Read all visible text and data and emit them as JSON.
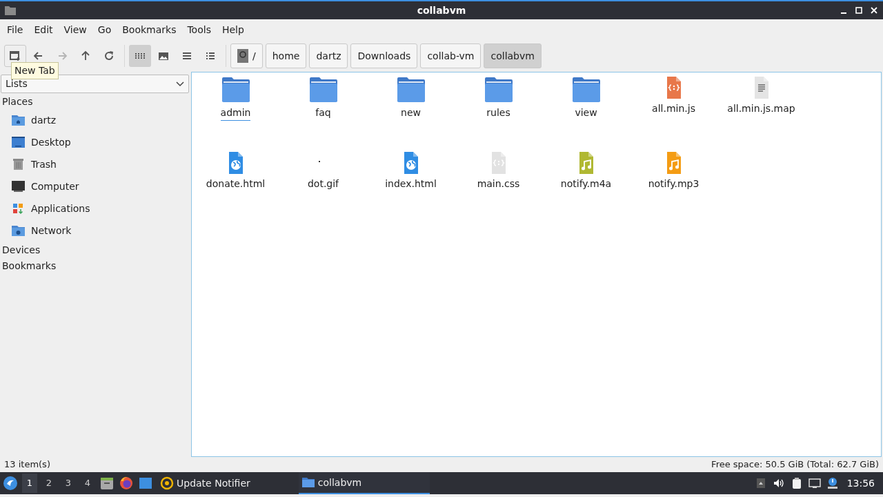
{
  "window": {
    "title": "collabvm"
  },
  "menu": [
    "File",
    "Edit",
    "View",
    "Go",
    "Bookmarks",
    "Tools",
    "Help"
  ],
  "toolbar": {
    "navigation": [
      {
        "kind": "new-tab",
        "disabled": false
      },
      {
        "kind": "back",
        "disabled": false
      },
      {
        "kind": "forward",
        "disabled": true
      },
      {
        "kind": "up",
        "disabled": false
      },
      {
        "kind": "reload",
        "disabled": false
      }
    ],
    "view_modes": [
      {
        "kind": "icon-view",
        "selected": true
      },
      {
        "kind": "thumbnail-view",
        "selected": false
      },
      {
        "kind": "compact-view",
        "selected": false
      },
      {
        "kind": "list-view",
        "selected": false
      }
    ]
  },
  "tooltip": "New Tab",
  "path": [
    {
      "label": "/",
      "kind": "root",
      "selected": false
    },
    {
      "label": "home",
      "kind": "dir",
      "selected": false
    },
    {
      "label": "dartz",
      "kind": "dir",
      "selected": false
    },
    {
      "label": "Downloads",
      "kind": "dir",
      "selected": false
    },
    {
      "label": "collab-vm",
      "kind": "dir",
      "selected": false
    },
    {
      "label": "collabvm",
      "kind": "dir",
      "selected": true
    }
  ],
  "sidebar": {
    "mode": "Lists",
    "sections": [
      {
        "title": "Places",
        "items": [
          {
            "label": "dartz",
            "kind": "home"
          },
          {
            "label": "Desktop",
            "kind": "desktop"
          },
          {
            "label": "Trash",
            "kind": "trash"
          },
          {
            "label": "Computer",
            "kind": "computer"
          },
          {
            "label": "Applications",
            "kind": "apps"
          },
          {
            "label": "Network",
            "kind": "network"
          }
        ]
      },
      {
        "title": "Devices"
      },
      {
        "title": "Bookmarks"
      }
    ]
  },
  "files": [
    {
      "name": "admin",
      "kind": "folder",
      "focused": true
    },
    {
      "name": "faq",
      "kind": "folder",
      "focused": false
    },
    {
      "name": "new",
      "kind": "folder",
      "focused": false
    },
    {
      "name": "rules",
      "kind": "folder",
      "focused": false
    },
    {
      "name": "view",
      "kind": "folder",
      "focused": false
    },
    {
      "name": "all.min.js",
      "kind": "code",
      "color": "#e8774a",
      "focused": false
    },
    {
      "name": "all.min.js.map",
      "kind": "text",
      "focused": false
    },
    {
      "name": "donate.html",
      "kind": "html",
      "focused": false
    },
    {
      "name": "dot.gif",
      "kind": "image",
      "focused": false
    },
    {
      "name": "index.html",
      "kind": "html",
      "focused": false
    },
    {
      "name": "main.css",
      "kind": "code",
      "color": "#e2e2e2",
      "focused": false
    },
    {
      "name": "notify.m4a",
      "kind": "audio",
      "color": "#b0b832",
      "focused": false
    },
    {
      "name": "notify.mp3",
      "kind": "audio",
      "color": "#f49c14",
      "focused": false
    }
  ],
  "status_bar": {
    "items": "13 item(s)",
    "space": "Free space: 50.5 GiB (Total: 62.7 GiB)"
  },
  "taskbar": {
    "workspaces": [
      {
        "label": "1",
        "selected": true
      },
      {
        "label": "2",
        "selected": false
      },
      {
        "label": "3",
        "selected": false
      },
      {
        "label": "4",
        "selected": false
      }
    ],
    "launchers": [
      {
        "kind": "files"
      },
      {
        "kind": "browser"
      },
      {
        "kind": "desktop"
      }
    ],
    "tasks": [
      {
        "label": "Update Notifier",
        "kind": "updater",
        "selected": false
      },
      {
        "label": "collabvm",
        "kind": "folder",
        "selected": true
      }
    ],
    "tray": [
      {
        "kind": "arrow"
      },
      {
        "kind": "volume"
      },
      {
        "kind": "clipboard"
      },
      {
        "kind": "network"
      },
      {
        "kind": "alert"
      }
    ],
    "clock": "13:56"
  }
}
